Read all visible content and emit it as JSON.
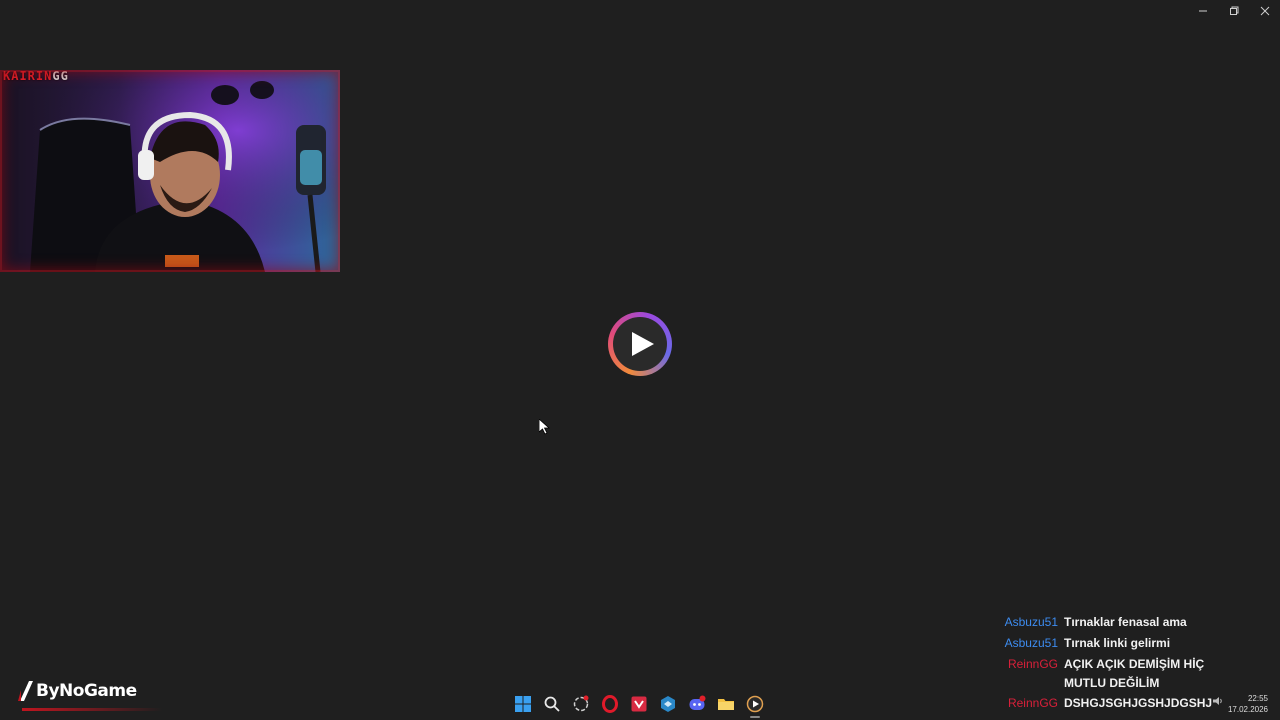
{
  "window": {
    "controls": [
      "minimize",
      "restore",
      "close"
    ]
  },
  "webcam": {
    "title_red": "KAIRIN",
    "title_rest": "GG",
    "chair_text": [
      "HAWK",
      "HAWK"
    ]
  },
  "player": {
    "icon": "play-icon"
  },
  "chat": {
    "messages": [
      {
        "user": "Asbuzu51",
        "color": "#3d8cf0",
        "text": "Tırnaklar fenasal ama"
      },
      {
        "user": "Asbuzu51",
        "color": "#3d8cf0",
        "text": "Tırnak linki gelirmi"
      },
      {
        "user": "ReinnGG",
        "color": "#d8203a",
        "text": "AÇIK AÇIK DEMİŞİM HİÇ MUTLU DEĞİLİM"
      },
      {
        "user": "ReinnGG",
        "color": "#d8203a",
        "text": "DSHGJSGHJGSHJDGSHJ"
      }
    ]
  },
  "brand": {
    "name": "ByNoGame"
  },
  "taskbar": {
    "icons": [
      "windows-start-icon",
      "search-icon",
      "chatgpt-icon",
      "opera-icon",
      "vivaldi-icon",
      "app-icon",
      "discord-icon",
      "file-explorer-icon",
      "media-player-icon"
    ],
    "notification_badge": "5"
  },
  "clock": {
    "time": "22:55",
    "date": "17.02.2026"
  }
}
